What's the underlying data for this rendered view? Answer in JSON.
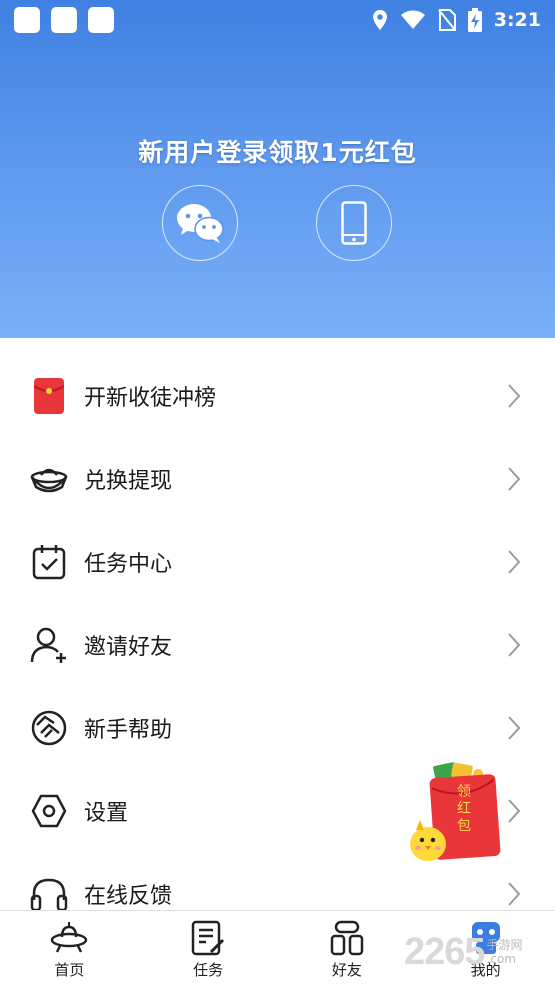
{
  "status_bar": {
    "time": "3:21",
    "icons": [
      "notification-square-icon",
      "notification-square-icon",
      "notification-square-icon",
      "location-icon",
      "wifi-icon",
      "no-sim-icon",
      "battery-charging-icon"
    ]
  },
  "header": {
    "login_title": "新用户登录领取1元红包",
    "login_options": [
      {
        "icon": "wechat-icon"
      },
      {
        "icon": "phone-icon"
      }
    ]
  },
  "menu": {
    "items": [
      {
        "label": "开新收徒冲榜",
        "icon": "red-envelope-icon"
      },
      {
        "label": "兑换提现",
        "icon": "gold-ingot-icon"
      },
      {
        "label": "任务中心",
        "icon": "calendar-check-icon"
      },
      {
        "label": "邀请好友",
        "icon": "user-add-icon"
      },
      {
        "label": "新手帮助",
        "icon": "handshake-icon"
      },
      {
        "label": "设置",
        "icon": "hexagon-settings-icon"
      },
      {
        "label": "在线反馈",
        "icon": "headset-icon"
      }
    ]
  },
  "floating_badge": {
    "text": "领红包"
  },
  "bottom_nav": {
    "items": [
      {
        "label": "首页",
        "icon": "ufo-icon",
        "active": false
      },
      {
        "label": "任务",
        "icon": "task-list-icon",
        "active": false
      },
      {
        "label": "好友",
        "icon": "friends-icon",
        "active": false
      },
      {
        "label": "我的",
        "icon": "robot-icon",
        "active": true
      }
    ]
  },
  "watermark": {
    "number": "2265",
    "text": "手游网",
    "domain": ".com"
  },
  "colors": {
    "header_top": "#3f80e2",
    "header_bottom": "#79b0f7",
    "accent_red": "#e8363b",
    "active_blue": "#3b7de0"
  }
}
